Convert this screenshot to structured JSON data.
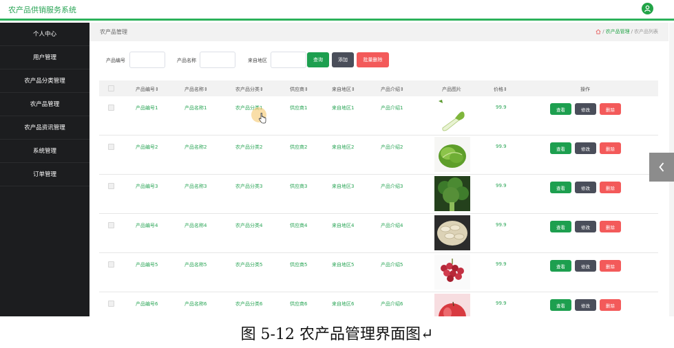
{
  "app": {
    "title": "农产品供销服务系统",
    "user_icon": "user-icon"
  },
  "sidebar": {
    "items": [
      {
        "label": "个人中心"
      },
      {
        "label": "用户管理"
      },
      {
        "label": "农产品分类管理"
      },
      {
        "label": "农产品管理"
      },
      {
        "label": "农产品资讯管理"
      },
      {
        "label": "系统管理"
      },
      {
        "label": "订单管理"
      }
    ]
  },
  "breadcrumb": {
    "page_title": "农产品管理",
    "home_icon": "home-icon",
    "sep": "/",
    "section": "农产品管理",
    "current": "农产品列表"
  },
  "search": {
    "fields": [
      {
        "label": "产品编号",
        "value": ""
      },
      {
        "label": "产品名称",
        "value": ""
      },
      {
        "label": "来自地区",
        "value": ""
      }
    ],
    "query_label": "查询",
    "add_label": "添加",
    "batch_delete_label": "批量删除"
  },
  "table": {
    "headers": [
      "产品编号⇕",
      "产品名称⇕",
      "农产品分类⇕",
      "供应商⇕",
      "来自地区⇕",
      "产品介绍⇕",
      "产品图片",
      "价格⇕",
      "操作"
    ],
    "rows": [
      {
        "code": "产品编号1",
        "name": "产品名称1",
        "category": "农产品分类1",
        "supplier": "供应商1",
        "region": "来自地区1",
        "intro": "产品介绍1",
        "image": "lettuce-stalk",
        "price": "99.9"
      },
      {
        "code": "产品编号2",
        "name": "产品名称2",
        "category": "农产品分类2",
        "supplier": "供应商2",
        "region": "来自地区2",
        "intro": "产品介绍2",
        "image": "lettuce",
        "price": "99.9"
      },
      {
        "code": "产品编号3",
        "name": "产品名称3",
        "category": "农产品分类3",
        "supplier": "供应商3",
        "region": "来自地区3",
        "intro": "产品介绍3",
        "image": "broccoli",
        "price": "99.9"
      },
      {
        "code": "产品编号4",
        "name": "产品名称4",
        "category": "农产品分类4",
        "supplier": "供应商4",
        "region": "来自地区4",
        "intro": "产品介绍4",
        "image": "seeds",
        "price": "99.9"
      },
      {
        "code": "产品编号5",
        "name": "产品名称5",
        "category": "农产品分类5",
        "supplier": "供应商5",
        "region": "来自地区5",
        "intro": "产品介绍5",
        "image": "grapes",
        "price": "99.9"
      },
      {
        "code": "产品编号6",
        "name": "产品名称6",
        "category": "农产品分类6",
        "supplier": "供应商6",
        "region": "来自地区6",
        "intro": "产品介绍6",
        "image": "apple",
        "price": "99.9"
      }
    ],
    "actions": {
      "view": "查看",
      "edit": "修改",
      "delete": "删除"
    }
  },
  "colors": {
    "accent": "#2bb15a",
    "text_green": "#2aa556",
    "btn_view": "#1d9f4f",
    "btn_edit": "#4a4e5a",
    "btn_delete": "#f35a5a",
    "sidebar_bg": "#1c1d1f"
  },
  "caption": "图 5-12 农产品管理界面图↵"
}
